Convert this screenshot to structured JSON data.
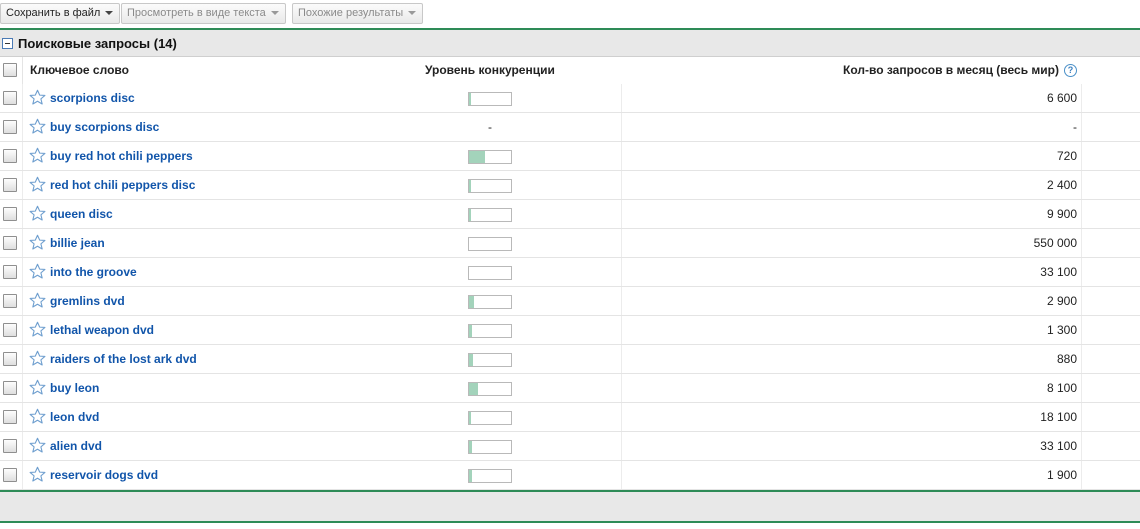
{
  "toolbar": {
    "save_label": "Сохранить в файл",
    "view_text_label": "Просмотреть в виде текста",
    "similar_label": "Похожие результаты"
  },
  "section": {
    "title": "Поисковые запросы (14)"
  },
  "table": {
    "headers": {
      "keyword": "Ключевое слово",
      "competition": "Уровень конкуренции",
      "volume": "Кол-во запросов в месяц (весь мир)",
      "help_icon_glyph": "?"
    },
    "rows": [
      {
        "keyword": "scorpions disc",
        "competition_level": 0.05,
        "volume": "6 600"
      },
      {
        "keyword": "buy scorpions disc",
        "competition_level": null,
        "competition_text": "-",
        "volume": "-"
      },
      {
        "keyword": "buy red hot chili peppers",
        "competition_level": 0.38,
        "volume": "720"
      },
      {
        "keyword": "red hot chili peppers disc",
        "competition_level": 0.05,
        "volume": "2 400"
      },
      {
        "keyword": "queen disc",
        "competition_level": 0.05,
        "volume": "9 900"
      },
      {
        "keyword": "billie jean",
        "competition_level": 0.0,
        "volume": "550 000"
      },
      {
        "keyword": "into the groove",
        "competition_level": 0.0,
        "volume": "33 100"
      },
      {
        "keyword": "gremlins dvd",
        "competition_level": 0.12,
        "volume": "2 900"
      },
      {
        "keyword": "lethal weapon dvd",
        "competition_level": 0.07,
        "volume": "1 300"
      },
      {
        "keyword": "raiders of the lost ark dvd",
        "competition_level": 0.09,
        "volume": "880"
      },
      {
        "keyword": "buy leon",
        "competition_level": 0.21,
        "volume": "8 100"
      },
      {
        "keyword": "leon dvd",
        "competition_level": 0.05,
        "volume": "18 100"
      },
      {
        "keyword": "alien dvd",
        "competition_level": 0.07,
        "volume": "33 100"
      },
      {
        "keyword": "reservoir dogs dvd",
        "competition_level": 0.07,
        "volume": "1 900"
      }
    ]
  },
  "colors": {
    "accent_green": "#2e8b57",
    "competition_fill": "#a3d3bb",
    "link_blue": "#1155aa"
  },
  "icons": {
    "collapse": "minus-box-icon",
    "star": "star-outline-icon",
    "dropdown": "chevron-down-icon",
    "help": "help-icon"
  }
}
